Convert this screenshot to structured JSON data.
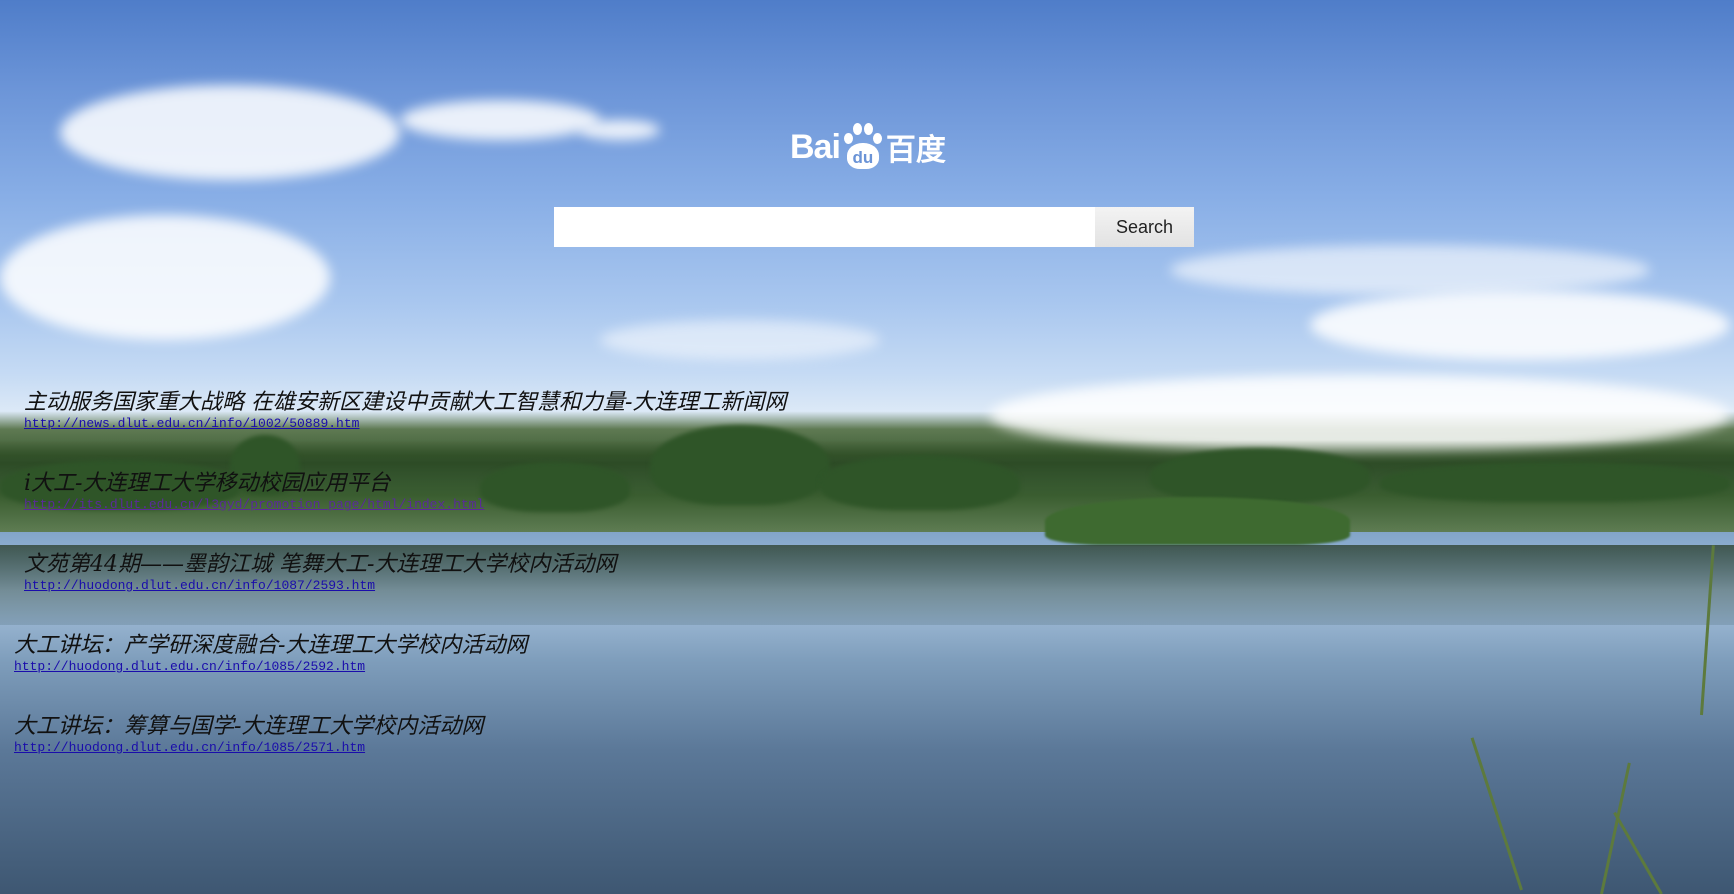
{
  "logo": {
    "latin": "Bai",
    "paw_text": "du",
    "chinese": "百度"
  },
  "search": {
    "value": "",
    "placeholder": "",
    "button_label": "Search"
  },
  "results": [
    {
      "title": "主动服务国家重大战略 在雄安新区建设中贡献大工智慧和力量-大连理工新闻网",
      "url": "http://news.dlut.edu.cn/info/1002/50889.htm"
    },
    {
      "title": "i大工-大连理工大学移动校园应用平台",
      "url": "http://its.dlut.edu.cn/l3gyd/promotion_page/html/index.html"
    },
    {
      "title": "文苑第44期——墨韵江城 笔舞大工-大连理工大学校内活动网",
      "url": "http://huodong.dlut.edu.cn/info/1087/2593.htm"
    },
    {
      "title": "大工讲坛：产学研深度融合-大连理工大学校内活动网",
      "url": "http://huodong.dlut.edu.cn/info/1085/2592.htm"
    },
    {
      "title": "大工讲坛：筹算与国学-大连理工大学校内活动网",
      "url": "http://huodong.dlut.edu.cn/info/1085/2571.htm"
    }
  ],
  "colors": {
    "link": "#1a0dab",
    "visited_link": "#5a2a9a",
    "title_text": "#111111"
  }
}
